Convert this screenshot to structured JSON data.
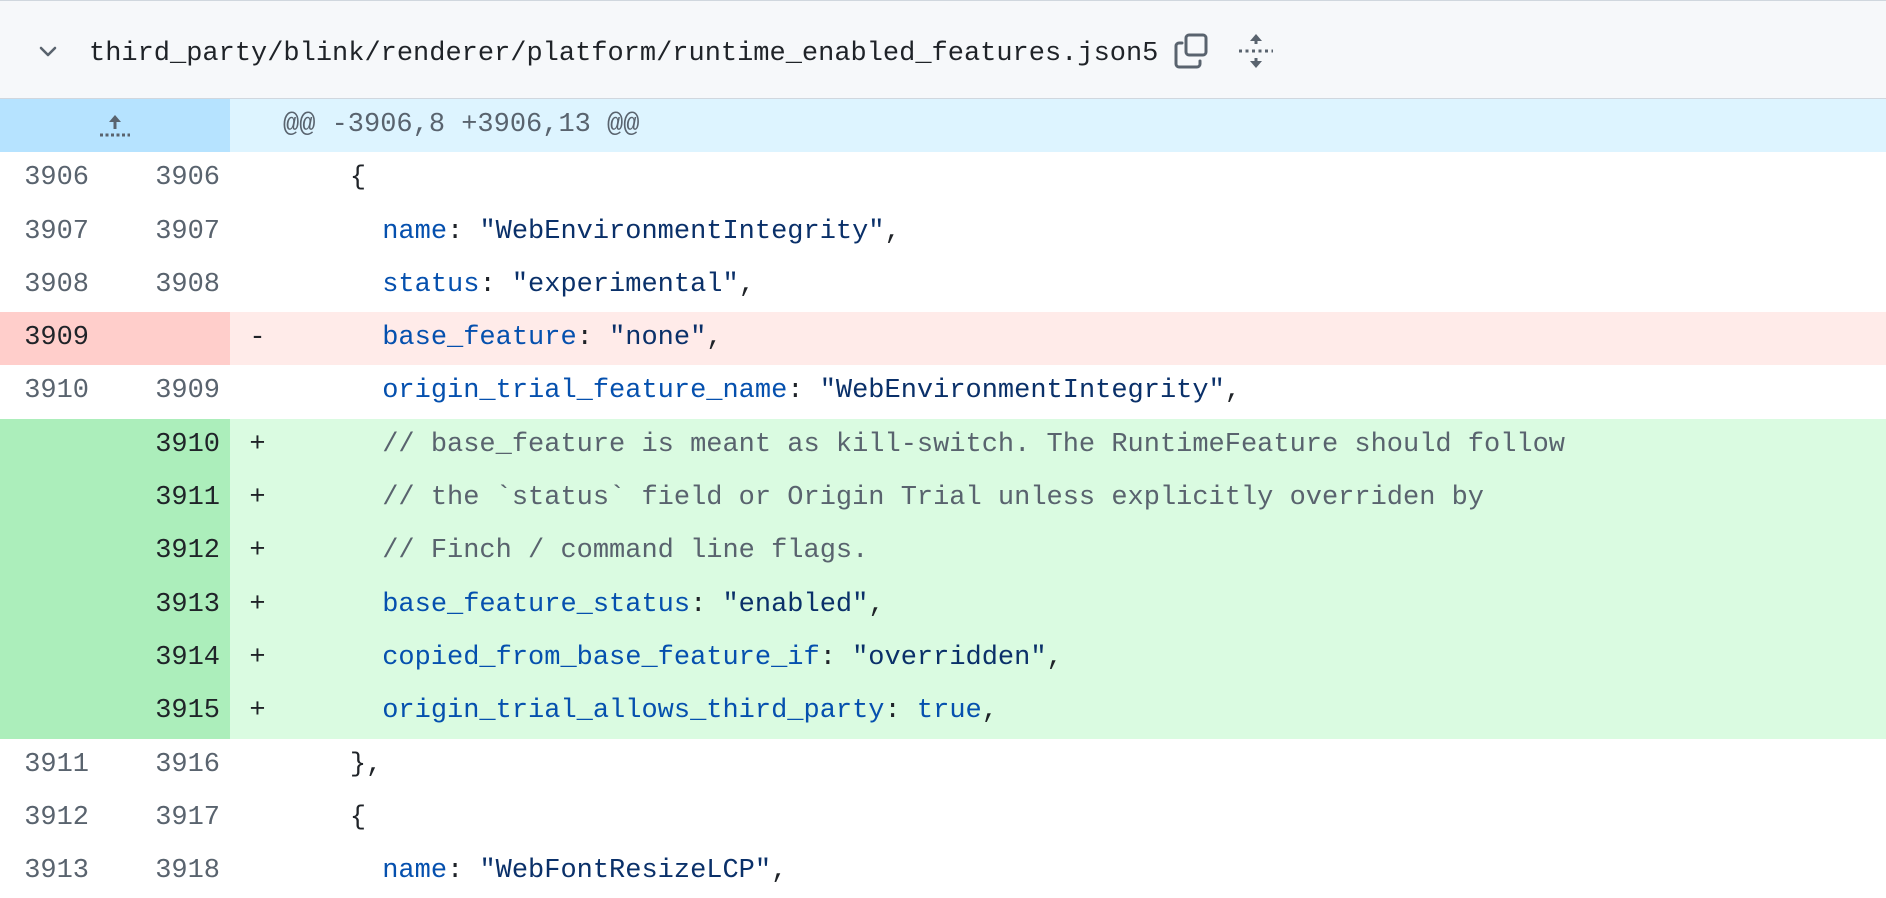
{
  "file": {
    "path": "third_party/blink/renderer/platform/runtime_enabled_features.json5"
  },
  "hunk": {
    "header": "@@ -3906,8 +3906,13 @@"
  },
  "lines": [
    {
      "type": "context",
      "old": "3906",
      "new": "3906",
      "marker": "",
      "indent": "    ",
      "parts": [
        {
          "t": "p",
          "v": "{"
        }
      ]
    },
    {
      "type": "context",
      "old": "3907",
      "new": "3907",
      "marker": "",
      "indent": "      ",
      "parts": [
        {
          "t": "k",
          "v": "name"
        },
        {
          "t": "p",
          "v": ": "
        },
        {
          "t": "s",
          "v": "\"WebEnvironmentIntegrity\""
        },
        {
          "t": "p",
          "v": ","
        }
      ]
    },
    {
      "type": "context",
      "old": "3908",
      "new": "3908",
      "marker": "",
      "indent": "      ",
      "parts": [
        {
          "t": "k",
          "v": "status"
        },
        {
          "t": "p",
          "v": ": "
        },
        {
          "t": "s",
          "v": "\"experimental\""
        },
        {
          "t": "p",
          "v": ","
        }
      ]
    },
    {
      "type": "del",
      "old": "3909",
      "new": "",
      "marker": "-",
      "indent": "      ",
      "parts": [
        {
          "t": "k",
          "v": "base_feature"
        },
        {
          "t": "p",
          "v": ": "
        },
        {
          "t": "s",
          "v": "\"none\""
        },
        {
          "t": "p",
          "v": ","
        }
      ]
    },
    {
      "type": "context",
      "old": "3910",
      "new": "3909",
      "marker": "",
      "indent": "      ",
      "parts": [
        {
          "t": "k",
          "v": "origin_trial_feature_name"
        },
        {
          "t": "p",
          "v": ": "
        },
        {
          "t": "s",
          "v": "\"WebEnvironmentIntegrity\""
        },
        {
          "t": "p",
          "v": ","
        }
      ]
    },
    {
      "type": "add",
      "old": "",
      "new": "3910",
      "marker": "+",
      "indent": "      ",
      "parts": [
        {
          "t": "c",
          "v": "// base_feature is meant as kill-switch. The RuntimeFeature should follow"
        }
      ]
    },
    {
      "type": "add",
      "old": "",
      "new": "3911",
      "marker": "+",
      "indent": "      ",
      "parts": [
        {
          "t": "c",
          "v": "// the `status` field or Origin Trial unless explicitly overriden by"
        }
      ]
    },
    {
      "type": "add",
      "old": "",
      "new": "3912",
      "marker": "+",
      "indent": "      ",
      "parts": [
        {
          "t": "c",
          "v": "// Finch / command line flags."
        }
      ]
    },
    {
      "type": "add",
      "old": "",
      "new": "3913",
      "marker": "+",
      "indent": "      ",
      "parts": [
        {
          "t": "k",
          "v": "base_feature_status"
        },
        {
          "t": "p",
          "v": ": "
        },
        {
          "t": "s",
          "v": "\"enabled\""
        },
        {
          "t": "p",
          "v": ","
        }
      ]
    },
    {
      "type": "add",
      "old": "",
      "new": "3914",
      "marker": "+",
      "indent": "      ",
      "parts": [
        {
          "t": "k",
          "v": "copied_from_base_feature_if"
        },
        {
          "t": "p",
          "v": ": "
        },
        {
          "t": "s",
          "v": "\"overridden\""
        },
        {
          "t": "p",
          "v": ","
        }
      ]
    },
    {
      "type": "add",
      "old": "",
      "new": "3915",
      "marker": "+",
      "indent": "      ",
      "parts": [
        {
          "t": "k",
          "v": "origin_trial_allows_third_party"
        },
        {
          "t": "p",
          "v": ": "
        },
        {
          "t": "k",
          "v": "true"
        },
        {
          "t": "p",
          "v": ","
        }
      ]
    },
    {
      "type": "context",
      "old": "3911",
      "new": "3916",
      "marker": "",
      "indent": "    ",
      "parts": [
        {
          "t": "p",
          "v": "},"
        }
      ]
    },
    {
      "type": "context",
      "old": "3912",
      "new": "3917",
      "marker": "",
      "indent": "    ",
      "parts": [
        {
          "t": "p",
          "v": "{"
        }
      ]
    },
    {
      "type": "context",
      "old": "3913",
      "new": "3918",
      "marker": "",
      "indent": "      ",
      "parts": [
        {
          "t": "k",
          "v": "name"
        },
        {
          "t": "p",
          "v": ": "
        },
        {
          "t": "s",
          "v": "\"WebFontResizeLCP\""
        },
        {
          "t": "p",
          "v": ","
        }
      ]
    }
  ],
  "colors": {
    "hunk_gutter": "#b6e3ff",
    "hunk_bg": "#ddf4ff",
    "del_num": "#ffcecb",
    "del_bg": "#ffebe9",
    "add_num": "#aceebb",
    "add_bg": "#dafbe1",
    "key": "#0550ae",
    "string": "#0a3069",
    "comment": "#59636e"
  },
  "icons": {
    "collapse": "chevron-down-icon",
    "copy": "copy-icon",
    "expand": "unfold-icon",
    "expand_up": "expand-up-icon"
  }
}
